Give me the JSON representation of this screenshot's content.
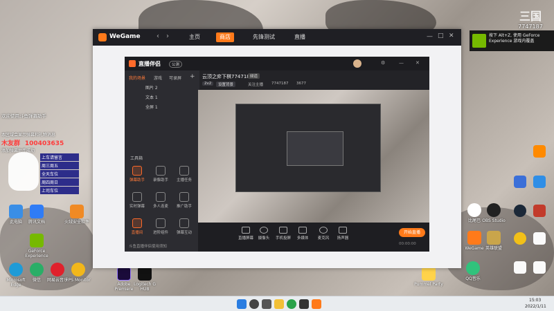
{
  "wegame": {
    "logo": "WeGame",
    "nav": [
      "主页",
      "商店",
      "先锋测试",
      "直播"
    ]
  },
  "streamer_app": {
    "title": "直播伴侣",
    "badge": "公测",
    "tabs": [
      "我的场景",
      "游戏",
      "可录屏"
    ],
    "scenes": [
      "图片 2",
      "文本 1",
      "全屏 1"
    ],
    "toolbox_label": "工具箱",
    "tools": [
      "弹幕助手",
      "录像助手",
      "主播任务",
      "实时弹幕",
      "多人连麦",
      "推广助手",
      "直播间",
      "进阶组件",
      "弹幕互动"
    ],
    "room_title": "云顶之弈下棋7747187",
    "room_tags": [
      "频道",
      "2v2",
      "设置背景"
    ],
    "room_id": "7747187",
    "room_count": "3677",
    "follow_hint": "关注主播",
    "bottom_tools": [
      "直播屏幕",
      "摄像头",
      "手机投屏",
      "多媒体",
      "麦克风",
      "扬声器"
    ],
    "start_button": "开始直播",
    "timer": "00:00:00",
    "notice_text": "斗鱼直播伴侣使用须知"
  },
  "chat_overlay": {
    "welcome": "欢迎使用斗鱼弹幕助手",
    "line2": "本区域会显示弹幕和礼物消息",
    "viewer_name": "木友群",
    "viewer_id": "100403635",
    "line4": "添加弹幕助手成功",
    "bunny_menu": [
      "上车请留言",
      "周三周五",
      "全天车位",
      "周四周日",
      "上司车位"
    ]
  },
  "gf_notice": {
    "text": "按下 Alt+Z, 使用 GeForce Experience 游戏内覆盖",
    "counter": "7747187"
  },
  "watermark": {
    "room": "7747187"
  },
  "desktop_icons": [
    "此电脑",
    "腾讯文档",
    "火绒安全软件",
    "Microsoft Edge",
    "微信",
    "网易云音乐",
    "Adobe Premiere",
    "Logitech G HUB",
    "GeForce Experience",
    "比尾巴",
    "OBS Studio",
    "英雄联盟",
    "WeGame",
    "QQ音乐",
    "Pummel Party",
    "FPS Monitor"
  ],
  "tray": {
    "time": "15:03",
    "date": "2022/1/11"
  },
  "colors": {
    "accent": "#ff7a1a",
    "wegame_bar": "#1f1f24",
    "streamer_bg": "#232327"
  }
}
